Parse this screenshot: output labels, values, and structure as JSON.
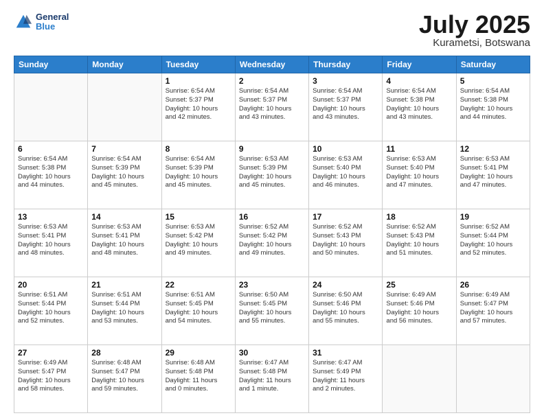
{
  "header": {
    "logo": {
      "line1": "General",
      "line2": "Blue"
    },
    "title": "July 2025",
    "subtitle": "Kurametsi, Botswana"
  },
  "weekdays": [
    "Sunday",
    "Monday",
    "Tuesday",
    "Wednesday",
    "Thursday",
    "Friday",
    "Saturday"
  ],
  "weeks": [
    [
      {
        "day": "",
        "info": ""
      },
      {
        "day": "",
        "info": ""
      },
      {
        "day": "1",
        "info": "Sunrise: 6:54 AM\nSunset: 5:37 PM\nDaylight: 10 hours\nand 42 minutes."
      },
      {
        "day": "2",
        "info": "Sunrise: 6:54 AM\nSunset: 5:37 PM\nDaylight: 10 hours\nand 43 minutes."
      },
      {
        "day": "3",
        "info": "Sunrise: 6:54 AM\nSunset: 5:37 PM\nDaylight: 10 hours\nand 43 minutes."
      },
      {
        "day": "4",
        "info": "Sunrise: 6:54 AM\nSunset: 5:38 PM\nDaylight: 10 hours\nand 43 minutes."
      },
      {
        "day": "5",
        "info": "Sunrise: 6:54 AM\nSunset: 5:38 PM\nDaylight: 10 hours\nand 44 minutes."
      }
    ],
    [
      {
        "day": "6",
        "info": "Sunrise: 6:54 AM\nSunset: 5:38 PM\nDaylight: 10 hours\nand 44 minutes."
      },
      {
        "day": "7",
        "info": "Sunrise: 6:54 AM\nSunset: 5:39 PM\nDaylight: 10 hours\nand 45 minutes."
      },
      {
        "day": "8",
        "info": "Sunrise: 6:54 AM\nSunset: 5:39 PM\nDaylight: 10 hours\nand 45 minutes."
      },
      {
        "day": "9",
        "info": "Sunrise: 6:53 AM\nSunset: 5:39 PM\nDaylight: 10 hours\nand 45 minutes."
      },
      {
        "day": "10",
        "info": "Sunrise: 6:53 AM\nSunset: 5:40 PM\nDaylight: 10 hours\nand 46 minutes."
      },
      {
        "day": "11",
        "info": "Sunrise: 6:53 AM\nSunset: 5:40 PM\nDaylight: 10 hours\nand 47 minutes."
      },
      {
        "day": "12",
        "info": "Sunrise: 6:53 AM\nSunset: 5:41 PM\nDaylight: 10 hours\nand 47 minutes."
      }
    ],
    [
      {
        "day": "13",
        "info": "Sunrise: 6:53 AM\nSunset: 5:41 PM\nDaylight: 10 hours\nand 48 minutes."
      },
      {
        "day": "14",
        "info": "Sunrise: 6:53 AM\nSunset: 5:41 PM\nDaylight: 10 hours\nand 48 minutes."
      },
      {
        "day": "15",
        "info": "Sunrise: 6:53 AM\nSunset: 5:42 PM\nDaylight: 10 hours\nand 49 minutes."
      },
      {
        "day": "16",
        "info": "Sunrise: 6:52 AM\nSunset: 5:42 PM\nDaylight: 10 hours\nand 49 minutes."
      },
      {
        "day": "17",
        "info": "Sunrise: 6:52 AM\nSunset: 5:43 PM\nDaylight: 10 hours\nand 50 minutes."
      },
      {
        "day": "18",
        "info": "Sunrise: 6:52 AM\nSunset: 5:43 PM\nDaylight: 10 hours\nand 51 minutes."
      },
      {
        "day": "19",
        "info": "Sunrise: 6:52 AM\nSunset: 5:44 PM\nDaylight: 10 hours\nand 52 minutes."
      }
    ],
    [
      {
        "day": "20",
        "info": "Sunrise: 6:51 AM\nSunset: 5:44 PM\nDaylight: 10 hours\nand 52 minutes."
      },
      {
        "day": "21",
        "info": "Sunrise: 6:51 AM\nSunset: 5:44 PM\nDaylight: 10 hours\nand 53 minutes."
      },
      {
        "day": "22",
        "info": "Sunrise: 6:51 AM\nSunset: 5:45 PM\nDaylight: 10 hours\nand 54 minutes."
      },
      {
        "day": "23",
        "info": "Sunrise: 6:50 AM\nSunset: 5:45 PM\nDaylight: 10 hours\nand 55 minutes."
      },
      {
        "day": "24",
        "info": "Sunrise: 6:50 AM\nSunset: 5:46 PM\nDaylight: 10 hours\nand 55 minutes."
      },
      {
        "day": "25",
        "info": "Sunrise: 6:49 AM\nSunset: 5:46 PM\nDaylight: 10 hours\nand 56 minutes."
      },
      {
        "day": "26",
        "info": "Sunrise: 6:49 AM\nSunset: 5:47 PM\nDaylight: 10 hours\nand 57 minutes."
      }
    ],
    [
      {
        "day": "27",
        "info": "Sunrise: 6:49 AM\nSunset: 5:47 PM\nDaylight: 10 hours\nand 58 minutes."
      },
      {
        "day": "28",
        "info": "Sunrise: 6:48 AM\nSunset: 5:47 PM\nDaylight: 10 hours\nand 59 minutes."
      },
      {
        "day": "29",
        "info": "Sunrise: 6:48 AM\nSunset: 5:48 PM\nDaylight: 11 hours\nand 0 minutes."
      },
      {
        "day": "30",
        "info": "Sunrise: 6:47 AM\nSunset: 5:48 PM\nDaylight: 11 hours\nand 1 minute."
      },
      {
        "day": "31",
        "info": "Sunrise: 6:47 AM\nSunset: 5:49 PM\nDaylight: 11 hours\nand 2 minutes."
      },
      {
        "day": "",
        "info": ""
      },
      {
        "day": "",
        "info": ""
      }
    ]
  ]
}
